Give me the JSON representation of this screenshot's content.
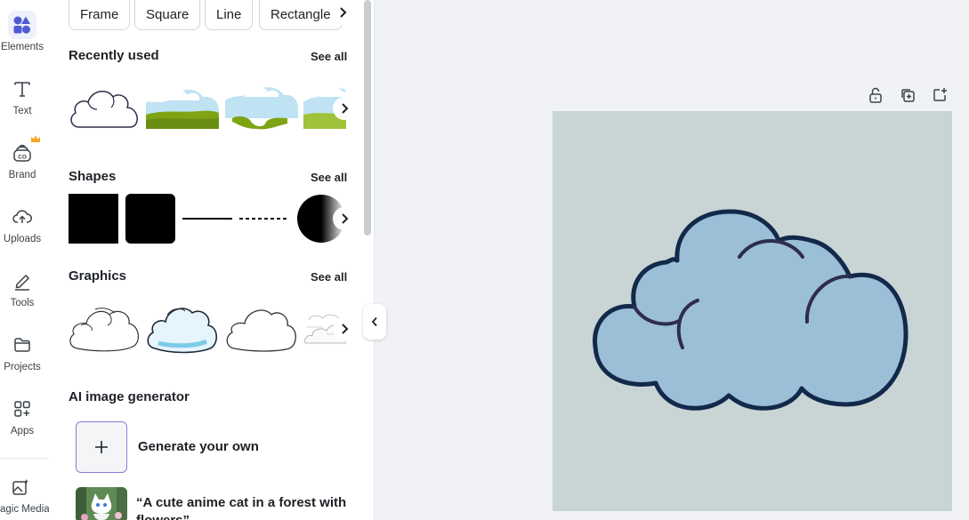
{
  "rail": {
    "items": [
      {
        "label": "Elements",
        "icon": "elements-icon"
      },
      {
        "label": "Text",
        "icon": "text-icon"
      },
      {
        "label": "Brand",
        "icon": "brand-icon"
      },
      {
        "label": "Uploads",
        "icon": "uploads-icon"
      },
      {
        "label": "Tools",
        "icon": "tools-icon"
      },
      {
        "label": "Projects",
        "icon": "projects-icon"
      },
      {
        "label": "Apps",
        "icon": "apps-icon"
      },
      {
        "label": "Magic Media",
        "icon": "magic-media-icon"
      }
    ]
  },
  "chips": [
    "Frame",
    "Square",
    "Line",
    "Rectangle"
  ],
  "sections": {
    "recently_used": {
      "title": "Recently used",
      "see_all": "See all"
    },
    "shapes": {
      "title": "Shapes",
      "see_all": "See all"
    },
    "graphics": {
      "title": "Graphics",
      "see_all": "See all"
    },
    "ai": {
      "title": "AI image generator"
    }
  },
  "ai_generator": {
    "generate_label": "Generate your own",
    "prompt_example": "“A cute anime cat in a forest with flowers”"
  },
  "colors": {
    "accent": "#5a4bd6",
    "canvas_bg": "#c9d4d4",
    "cloud_fill": "#9bbfd6",
    "cloud_stroke": "#13294b",
    "brand_crown": "#f5a524"
  }
}
